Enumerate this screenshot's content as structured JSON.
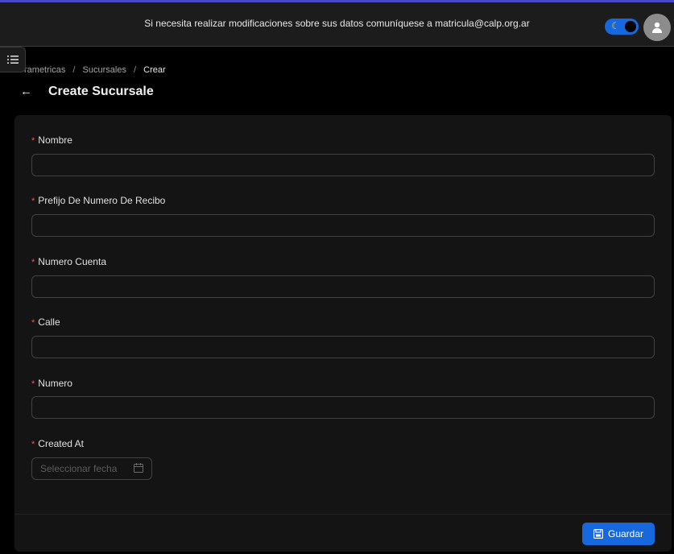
{
  "header": {
    "notice": "Si necesita realizar modificaciones sobre sus datos comuníquese a matricula@calp.org.ar",
    "theme_toggle_icon": "moon-icon",
    "avatar_icon": "user-icon"
  },
  "sider_toggle_icon": "menu-list-icon",
  "breadcrumb": {
    "items": [
      "rametricas",
      "Sucursales",
      "Crear"
    ],
    "separator": "/"
  },
  "page": {
    "back_icon": "←",
    "title": "Create Sucursale"
  },
  "form": {
    "required_mark": "*",
    "fields": [
      {
        "label": "Nombre",
        "value": ""
      },
      {
        "label": "Prefijo De Numero De Recibo",
        "value": ""
      },
      {
        "label": "Numero Cuenta",
        "value": ""
      },
      {
        "label": "Calle",
        "value": ""
      },
      {
        "label": "Numero",
        "value": ""
      }
    ],
    "date_field": {
      "label": "Created At",
      "placeholder": "Seleccionar fecha",
      "icon": "calendar-icon"
    },
    "save_label": "Guardar",
    "save_icon": "save-icon"
  },
  "colors": {
    "primary": "#1668dc",
    "required": "#ff4d4f",
    "background": "#000000",
    "card": "#141414"
  }
}
